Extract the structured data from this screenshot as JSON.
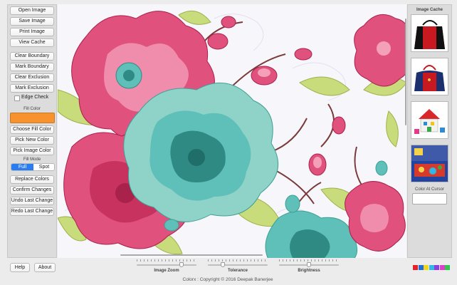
{
  "left_panel": {
    "open_image": "Open Image",
    "save_image": "Save Image",
    "print_image": "Print Image",
    "view_cache": "View Cache",
    "clear_boundary": "Clear Boundary",
    "mark_boundary": "Mark Boundary",
    "clear_exclusion": "Clear Exclusion",
    "mark_exclusion": "Mark Exclusion",
    "edge_check": "Edge Check",
    "edge_check_checked": false,
    "fill_color_label": "Fill Color",
    "fill_color": "#f7922f",
    "choose_fill_color": "Choose Fill Color",
    "pick_new_color": "Pick New Color",
    "pick_image_color": "Pick Image Color",
    "fill_mode_label": "Fill Mode",
    "fill_mode_options": [
      "Full",
      "Spot"
    ],
    "fill_mode_selected": "Full",
    "replace_colors": "Replace Colors",
    "confirm_changes": "Confirm Changes",
    "undo_last_change": "Undo Last Change",
    "redo_last_change": "Redo Last Change"
  },
  "right_panel": {
    "image_cache_label": "Image Cache",
    "thumbnails": [
      "handbag-red-black",
      "handbag-navy-red",
      "toy-house",
      "kids-bedroom"
    ],
    "color_at_cursor_label": "Color At Cursor"
  },
  "bottom": {
    "help": "Help",
    "about": "About",
    "image_zoom_label": "Image Zoom",
    "tolerance_label": "Tolerance",
    "brightness_label": "Brightness",
    "image_zoom_value": 0.75,
    "tolerance_value": 0.25,
    "brightness_value": 0.5,
    "copyright": "Colorx : Copyright © 2016  Deepak Banerjee",
    "palette": [
      "#e8202a",
      "#1e6fe0",
      "#f3d51a",
      "#2fb7e6",
      "#8e3de0",
      "#e23bd0",
      "#2fc84a"
    ]
  },
  "colors": {
    "accent": "#2a7cf1",
    "pink": "#e0517e",
    "teal": "#5fc0b9",
    "leaf": "#c9dc7c",
    "brown": "#7a3a3a"
  }
}
